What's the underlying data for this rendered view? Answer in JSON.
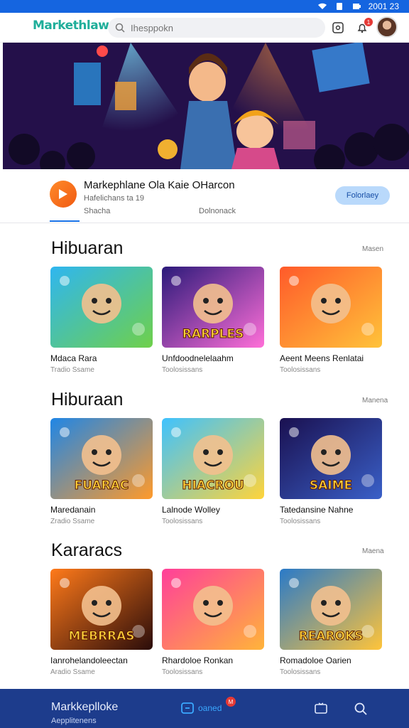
{
  "status_bar": {
    "time": "2001 23"
  },
  "header": {
    "logo": "Markethlaw",
    "search_placeholder": "Ihesppokn",
    "notification_count": "1"
  },
  "app": {
    "title": "Markephlane Ola Kaie OHarcon",
    "subtitle": "Hafelichans ta 19",
    "tab_1": "Shacha",
    "tab_2": "Dolnonack",
    "follow_label": "Folorlaey"
  },
  "sections": [
    {
      "title": "Hibuaran",
      "more": "Masen",
      "cards": [
        {
          "name": "Mdaca Rara",
          "meta": "Tradio Ssame",
          "thumb_text": ""
        },
        {
          "name": "Unfdoodnelelaahm",
          "meta": "Toolosissans",
          "thumb_text": "RARPLES"
        },
        {
          "name": "Aeent Meens Renlatai",
          "meta": "Toolosissans",
          "thumb_text": ""
        }
      ]
    },
    {
      "title": "Hiburaan",
      "more": "Manena",
      "cards": [
        {
          "name": "Maredanain",
          "meta": "Zradio Ssame",
          "thumb_text": "FUARAC"
        },
        {
          "name": "Lalnode Wolley",
          "meta": "Toolosissans",
          "thumb_text": "HIACROU"
        },
        {
          "name": "Tatedansine Nahne",
          "meta": "Toolosissans",
          "thumb_text": "SAIME"
        }
      ]
    },
    {
      "title": "Kararacs",
      "more": "Maena",
      "cards": [
        {
          "name": "Ianrohelandoleectan",
          "meta": "Aradio Ssame",
          "thumb_text": "MEBRRAS"
        },
        {
          "name": "Rhardoloe Ronkan",
          "meta": "Toolosissans",
          "thumb_text": ""
        },
        {
          "name": "Romadoloe Oarien",
          "meta": "Toolosissans",
          "thumb_text": "REAROKS"
        }
      ]
    }
  ],
  "bottom_nav": {
    "title": "Markkeplloke",
    "subtitle": "Aepplitenens",
    "games_label": "oaned",
    "badge": "M"
  },
  "colors": {
    "status_bar": "#1565e0",
    "logo": "#1fae9a",
    "bottom_nav": "#1d3c8c",
    "accent": "#1a73e8",
    "follow_bg": "#b9d9fb"
  }
}
